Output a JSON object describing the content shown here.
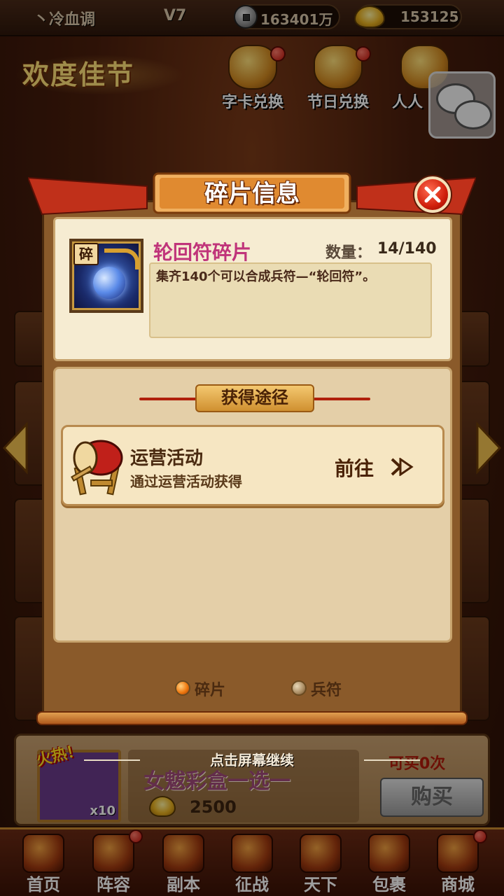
{
  "topbar": {
    "player_name": "丶冷血调",
    "vip_level": "V7",
    "copper_icon": "coin-icon",
    "copper_amount": "163401万",
    "gold_icon": "gold-ingot-icon",
    "gold_amount": "153125"
  },
  "event_banner": {
    "title": "欢度佳节",
    "icons": [
      {
        "label": "字卡兑换",
        "icon": "gift-bag-icon"
      },
      {
        "label": "节日兑换",
        "icon": "gift-bag-icon"
      },
      {
        "label": "人人",
        "icon": "gift-bag-icon"
      }
    ],
    "chat_icon": "chat-bubbles-icon"
  },
  "shop_card": {
    "hot_tag": "火热！",
    "item_name": "女魃彩盒一选一",
    "item_count": "x10",
    "price": "2500",
    "limit_text": "可买0次",
    "buy_label": "购买"
  },
  "bottom_nav": {
    "items": [
      {
        "label": "首页",
        "icon": "house-icon"
      },
      {
        "label": "阵容",
        "icon": "banner-icon"
      },
      {
        "label": "副本",
        "icon": "swords-icon"
      },
      {
        "label": "征战",
        "icon": "target-icon"
      },
      {
        "label": "天下",
        "icon": "scroll-icon"
      },
      {
        "label": "包裹",
        "icon": "bag-icon"
      },
      {
        "label": "商城",
        "icon": "gold-pile-icon"
      }
    ]
  },
  "overlay": {
    "continue_hint": "点击屏幕继续"
  },
  "dialog": {
    "title": "碎片信息",
    "close_icon": "close-icon",
    "item": {
      "badge": "碎",
      "name": "轮回符碎片",
      "quantity_label": "数量：",
      "quantity_value": "14/140",
      "description": "集齐140个可以合成兵符—“轮回符”。"
    },
    "sources": {
      "header": "获得途径",
      "entries": [
        {
          "icon": "war-drum-icon",
          "name": "运营活动",
          "description": "通过运营活动获得",
          "go_label": "前往"
        }
      ]
    },
    "tabs": [
      {
        "label": "碎片",
        "selected": true
      },
      {
        "label": "兵符",
        "selected": false
      }
    ]
  }
}
